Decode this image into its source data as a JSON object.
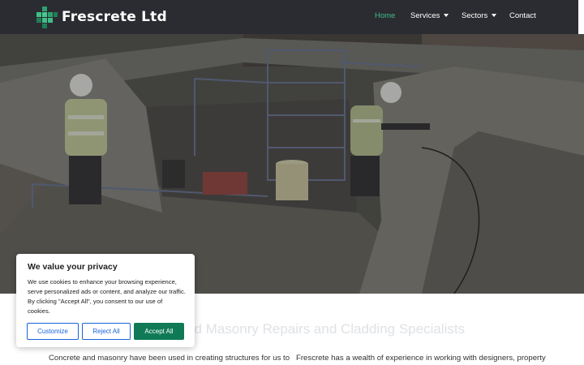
{
  "brand": {
    "name": "Frescrete Ltd"
  },
  "nav": {
    "items": [
      {
        "label": "Home",
        "active": true,
        "dropdown": false
      },
      {
        "label": "Services",
        "active": false,
        "dropdown": true
      },
      {
        "label": "Sectors",
        "active": false,
        "dropdown": true
      },
      {
        "label": "Contact",
        "active": false,
        "dropdown": false
      }
    ]
  },
  "hero": {
    "image_description_icon": "site-workers-photo"
  },
  "content": {
    "heading": "Concrete and Masonry Repairs and Cladding Specialists",
    "paragraph_left": "Concrete and masonry have been used in creating structures for us to",
    "paragraph_right": "Frescrete has a wealth of experience in working with designers, property"
  },
  "cookie": {
    "title": "We value your privacy",
    "text": "We use cookies to enhance your browsing experience, serve personalized ads or content, and analyze our traffic. By clicking \"Accept All\", you consent to our use of cookies.",
    "customize_label": "Customize",
    "reject_label": "Reject All",
    "accept_label": "Accept All"
  },
  "colors": {
    "header_bg": "#2b2c31",
    "accent_green": "#3fbf87",
    "accept_green": "#0f7a55",
    "button_blue": "#1863dc"
  }
}
